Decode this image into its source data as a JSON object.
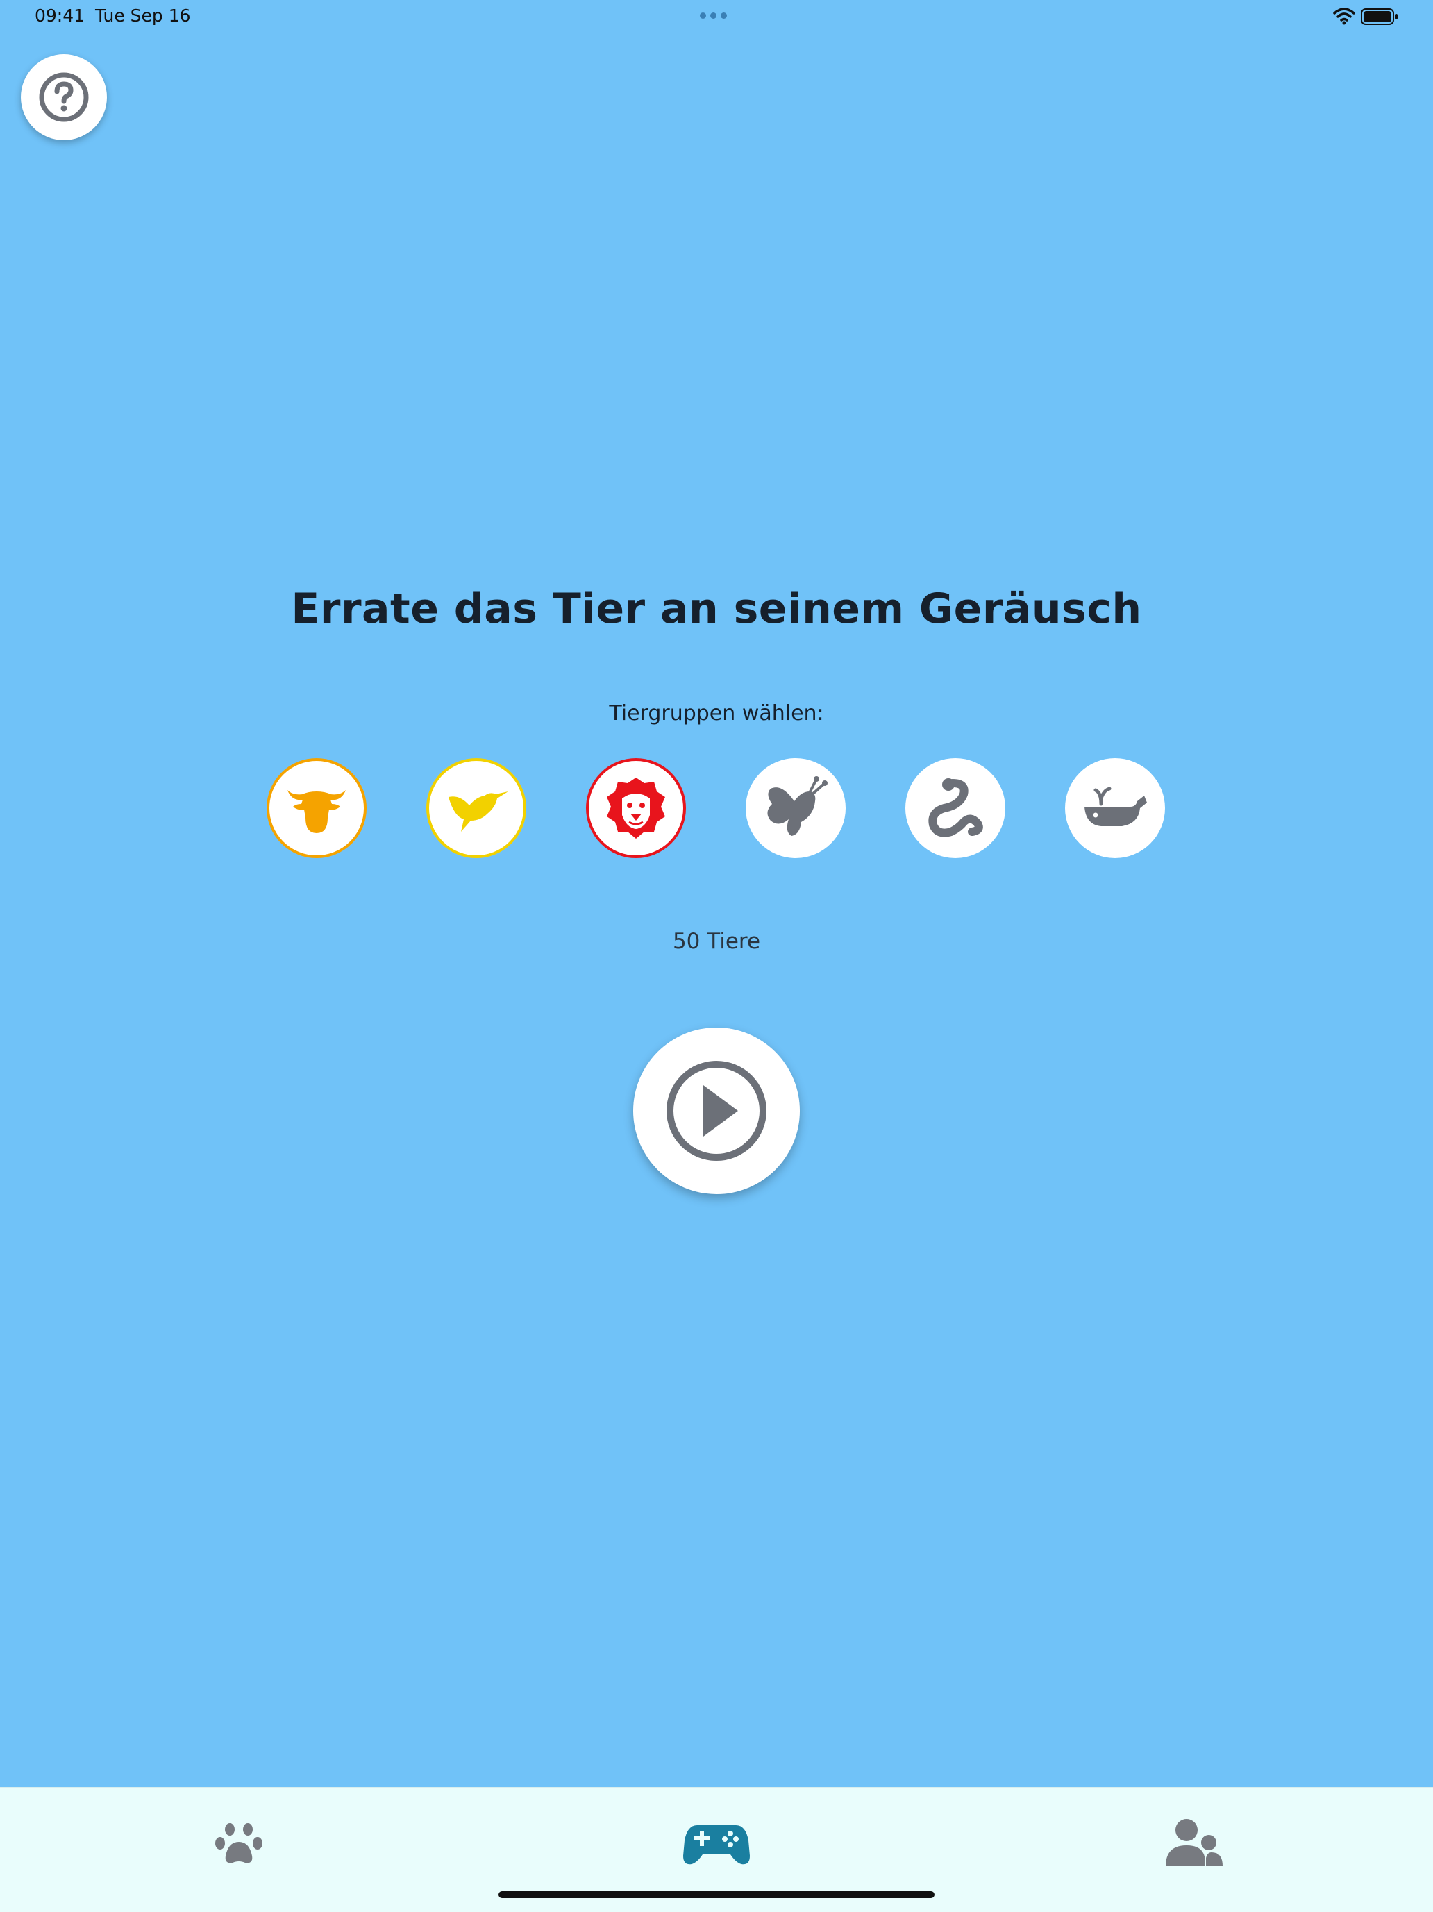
{
  "status_bar": {
    "time": "09:41",
    "date": "Tue Sep 16"
  },
  "help": {
    "icon": "question-circle-icon"
  },
  "main": {
    "title": "Errate das Tier an seinem Geräusch",
    "subtitle": "Tiergruppen wählen:",
    "groups": [
      {
        "icon": "cow-icon",
        "color": "#f5a300",
        "selected": true
      },
      {
        "icon": "bird-icon",
        "color": "#f2d100",
        "selected": true
      },
      {
        "icon": "lion-icon",
        "color": "#e8141c",
        "selected": true
      },
      {
        "icon": "butterfly-icon",
        "color": "#6c7078",
        "selected": false
      },
      {
        "icon": "snake-icon",
        "color": "#6c7078",
        "selected": false
      },
      {
        "icon": "whale-icon",
        "color": "#6c7078",
        "selected": false
      }
    ],
    "count_text": "50 Tiere",
    "play_icon": "play-icon"
  },
  "tab_bar": {
    "tabs": [
      {
        "icon": "paw-icon",
        "active": false
      },
      {
        "icon": "gamepad-icon",
        "active": true
      },
      {
        "icon": "users-icon",
        "active": false
      }
    ],
    "active_color": "#1a7fa0",
    "inactive_color": "#777a80"
  }
}
